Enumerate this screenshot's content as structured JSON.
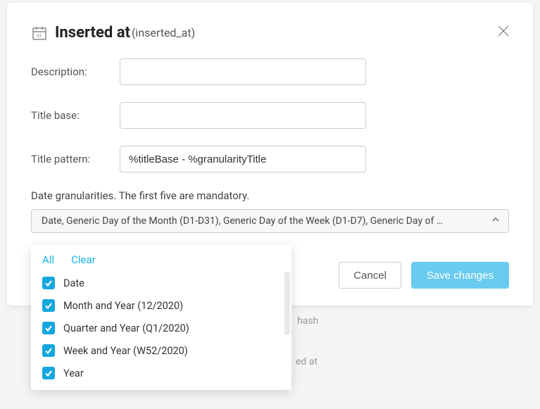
{
  "header": {
    "title": "Inserted at",
    "field_name": "(inserted_at)"
  },
  "form": {
    "description_label": "Description:",
    "description_value": "",
    "title_base_label": "Title base:",
    "title_base_value": "",
    "title_pattern_label": "Title pattern:",
    "title_pattern_value": "%titleBase - %granularityTitle"
  },
  "granularity": {
    "label": "Date granularities. The first five are mandatory.",
    "selected_summary": "Date, Generic Day of the Month (D1-D31), Generic Day of the Week (D1-D7), Generic Day of …"
  },
  "dropdown": {
    "all_label": "All",
    "clear_label": "Clear",
    "items": [
      {
        "label": "Date",
        "checked": true
      },
      {
        "label": "Month and Year (12/2020)",
        "checked": true
      },
      {
        "label": "Quarter and Year (Q1/2020)",
        "checked": true
      },
      {
        "label": "Week and Year (W52/2020)",
        "checked": true
      },
      {
        "label": "Year",
        "checked": true
      }
    ]
  },
  "actions": {
    "cancel": "Cancel",
    "save": "Save changes"
  },
  "background": {
    "hash_text": "hash",
    "ed_at_text": "ed at"
  }
}
